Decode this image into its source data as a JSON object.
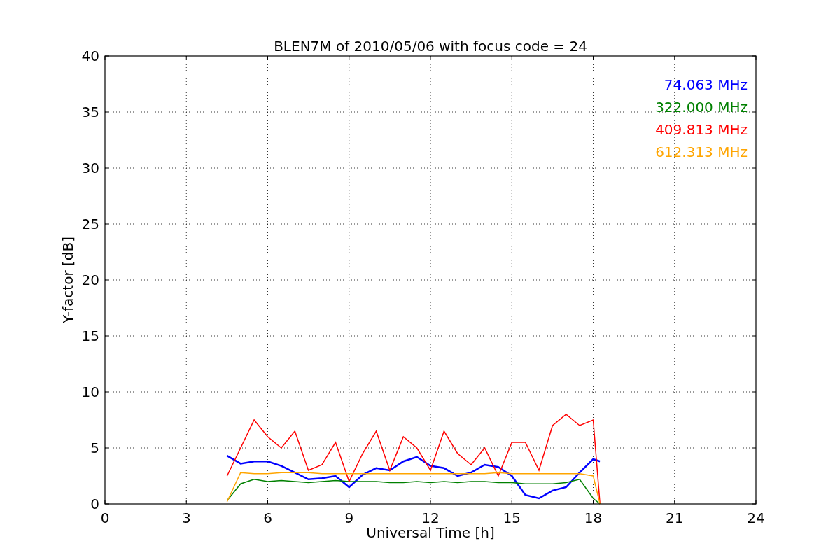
{
  "figure": {
    "chart_data": {
      "type": "line",
      "title": "BLEN7M of 2010/05/06 with focus code = 24",
      "xlabel": "Universal Time [h]",
      "ylabel": "Y-factor [dB]",
      "x": [
        4.5,
        5,
        5.5,
        6,
        6.5,
        7,
        7.5,
        8,
        8.5,
        9,
        9.5,
        10,
        10.5,
        11,
        11.5,
        12,
        12.5,
        13,
        13.5,
        14,
        14.5,
        15,
        15.5,
        16,
        16.5,
        17,
        17.5,
        18,
        18.25
      ],
      "series": [
        {
          "name": "74.063 MHz",
          "color": "#0000ff",
          "values": [
            4.3,
            3.6,
            3.8,
            3.8,
            3.4,
            2.8,
            2.2,
            2.3,
            2.5,
            1.5,
            2.6,
            3.2,
            3.0,
            3.8,
            4.2,
            3.4,
            3.2,
            2.5,
            2.8,
            3.5,
            3.3,
            2.5,
            0.8,
            0.5,
            1.2,
            1.5,
            2.8,
            4.0,
            3.8
          ]
        },
        {
          "name": "322.000 MHz",
          "color": "#008000",
          "values": [
            0.3,
            1.8,
            2.2,
            2.0,
            2.1,
            2.0,
            1.9,
            2.0,
            2.1,
            2.0,
            2.0,
            2.0,
            1.9,
            1.9,
            2.0,
            1.9,
            2.0,
            1.9,
            2.0,
            2.0,
            1.9,
            1.9,
            1.8,
            1.8,
            1.8,
            1.9,
            2.2,
            0.5,
            0.0
          ]
        },
        {
          "name": "409.813 MHz",
          "color": "#ff0000",
          "values": [
            2.5,
            5.0,
            7.5,
            6.0,
            5.0,
            6.5,
            3.0,
            3.5,
            5.5,
            2.0,
            4.5,
            6.5,
            3.0,
            6.0,
            5.0,
            3.0,
            6.5,
            4.5,
            3.5,
            5.0,
            2.5,
            5.5,
            5.5,
            3.0,
            7.0,
            8.0,
            7.0,
            7.5,
            0.0
          ]
        },
        {
          "name": "612.313 MHz",
          "color": "#ffa500",
          "values": [
            0.2,
            2.8,
            2.7,
            2.7,
            2.8,
            2.8,
            2.8,
            2.7,
            2.7,
            2.7,
            2.7,
            2.7,
            2.7,
            2.7,
            2.7,
            2.7,
            2.7,
            2.7,
            2.7,
            2.7,
            2.8,
            2.7,
            2.7,
            2.7,
            2.7,
            2.7,
            2.7,
            2.5,
            0.0
          ]
        }
      ],
      "grid": true,
      "xlim": [
        0,
        24
      ],
      "ylim": [
        0,
        40
      ],
      "xticks": [
        0,
        3,
        6,
        9,
        12,
        15,
        18,
        21,
        24
      ],
      "yticks": [
        0,
        5,
        10,
        15,
        20,
        25,
        30,
        35,
        40
      ]
    }
  }
}
